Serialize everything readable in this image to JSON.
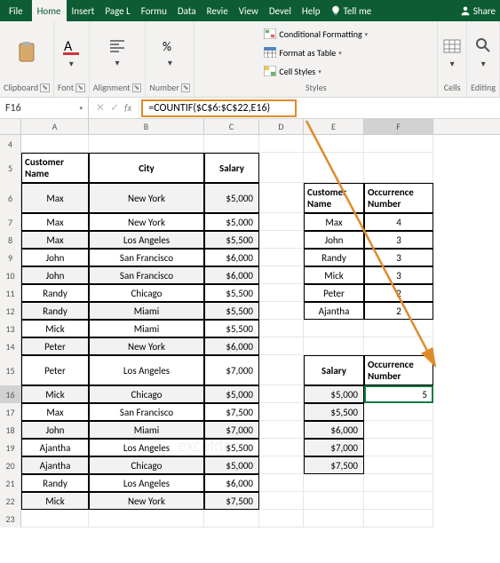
{
  "tabs": {
    "file": "File",
    "home": "Home",
    "insert": "Insert",
    "page": "Page L",
    "formu": "Formu",
    "data": "Data",
    "review": "Revie",
    "view": "View",
    "devel": "Devel",
    "help": "Help",
    "tellme": "Tell me",
    "share": "Share"
  },
  "ribbon_groups": {
    "clipboard": "Clipboard",
    "font": "Font",
    "alignment": "Alignment",
    "number": "Number",
    "styles": "Styles",
    "cells": "Cells",
    "editing": "Editing",
    "cond_fmt": "Conditional Formatting",
    "fmt_table": "Format as Table",
    "cell_styles": "Cell Styles"
  },
  "namebox": "F16",
  "formula": "=COUNTIF($C$6:$C$22,E16)",
  "watermark": "exceldemy",
  "cols": [
    "A",
    "B",
    "C",
    "D",
    "E",
    "F"
  ],
  "main_rows": [
    {
      "r": 4,
      "h": "",
      "a": "",
      "b": "",
      "c": ""
    },
    {
      "r": 5,
      "h": "tall",
      "hdr": true,
      "a": "Customer Name",
      "b": "City",
      "c": "Salary"
    },
    {
      "r": 6,
      "a": "Max",
      "b": "New York",
      "c": "$5,000",
      "shade": true,
      "tall": true
    },
    {
      "r": 7,
      "a": "Max",
      "b": "New York",
      "c": "$5,000"
    },
    {
      "r": 8,
      "a": "Max",
      "b": "Los Angeles",
      "c": "$5,500",
      "shade": true
    },
    {
      "r": 9,
      "a": "John",
      "b": "San Francisco",
      "c": "$6,000"
    },
    {
      "r": 10,
      "a": "John",
      "b": "San Francisco",
      "c": "$6,000",
      "shade": true
    },
    {
      "r": 11,
      "a": "Randy",
      "b": "Chicago",
      "c": "$5,500"
    },
    {
      "r": 12,
      "a": "Randy",
      "b": "Miami",
      "c": "$5,500",
      "shade": true
    },
    {
      "r": 13,
      "a": "Mick",
      "b": "Miami",
      "c": "$5,500"
    },
    {
      "r": 14,
      "a": "Peter",
      "b": "New York",
      "c": "$6,000",
      "shade": true
    },
    {
      "r": 15,
      "a": "Peter",
      "b": "Los Angeles",
      "c": "$7,000",
      "tall": true
    },
    {
      "r": 16,
      "a": "Mick",
      "b": "Chicago",
      "c": "$5,000",
      "shade": true
    },
    {
      "r": 17,
      "a": "Max",
      "b": "San Francisco",
      "c": "$7,500"
    },
    {
      "r": 18,
      "a": "John",
      "b": "Miami",
      "c": "$7,000",
      "shade": true
    },
    {
      "r": 19,
      "a": "Ajantha",
      "b": "Los Angeles",
      "c": "$5,500"
    },
    {
      "r": 20,
      "a": "Ajantha",
      "b": "Chicago",
      "c": "$5,000",
      "shade": true
    },
    {
      "r": 21,
      "a": "Randy",
      "b": "Los Angeles",
      "c": "$6,000"
    },
    {
      "r": 22,
      "a": "Mick",
      "b": "New York",
      "c": "$7,500",
      "shade": true
    },
    {
      "r": 23,
      "a": "",
      "b": "",
      "c": ""
    }
  ],
  "side1_header": {
    "e": "Customer Name",
    "f": "Occurrence Number"
  },
  "side1_rows": [
    {
      "r": 7,
      "e": "Max",
      "f": "4"
    },
    {
      "r": 8,
      "e": "John",
      "f": "3"
    },
    {
      "r": 9,
      "e": "Randy",
      "f": "3"
    },
    {
      "r": 10,
      "e": "Mick",
      "f": "3"
    },
    {
      "r": 11,
      "e": "Peter",
      "f": "2"
    },
    {
      "r": 12,
      "e": "Ajantha",
      "f": "2"
    }
  ],
  "side2_header": {
    "e": "Salary",
    "f": "Occurrence Number"
  },
  "side2_rows": [
    {
      "r": 16,
      "e": "$5,000",
      "f": "5",
      "sel": true
    },
    {
      "r": 17,
      "e": "$5,500",
      "f": ""
    },
    {
      "r": 18,
      "e": "$6,000",
      "f": ""
    },
    {
      "r": 19,
      "e": "$7,000",
      "f": ""
    },
    {
      "r": 20,
      "e": "$7,500",
      "f": ""
    }
  ]
}
